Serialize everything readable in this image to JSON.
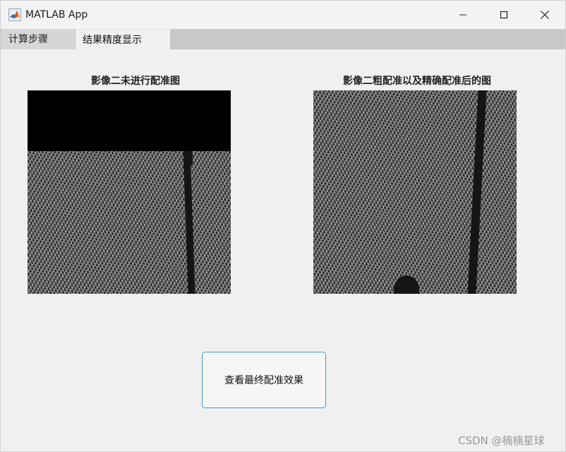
{
  "window": {
    "title": "MATLAB App",
    "icon": "matlab-logo-icon",
    "controls": [
      "minimize-icon",
      "maximize-icon",
      "close-icon"
    ]
  },
  "tabs": [
    {
      "label": "计算步骤",
      "selected": false
    },
    {
      "label": "结果精度显示",
      "selected": true
    }
  ],
  "panel": {
    "image_left": {
      "title": "影像二未进行配准图"
    },
    "image_right": {
      "title": "影像二粗配准以及精确配准后的图"
    },
    "action_button": {
      "label": "查看最终配准效果"
    }
  },
  "watermark": "CSDN @楠楠星球",
  "colors": {
    "button_border": "#3a9ad9",
    "tabstrip": "#c8c8c8"
  }
}
